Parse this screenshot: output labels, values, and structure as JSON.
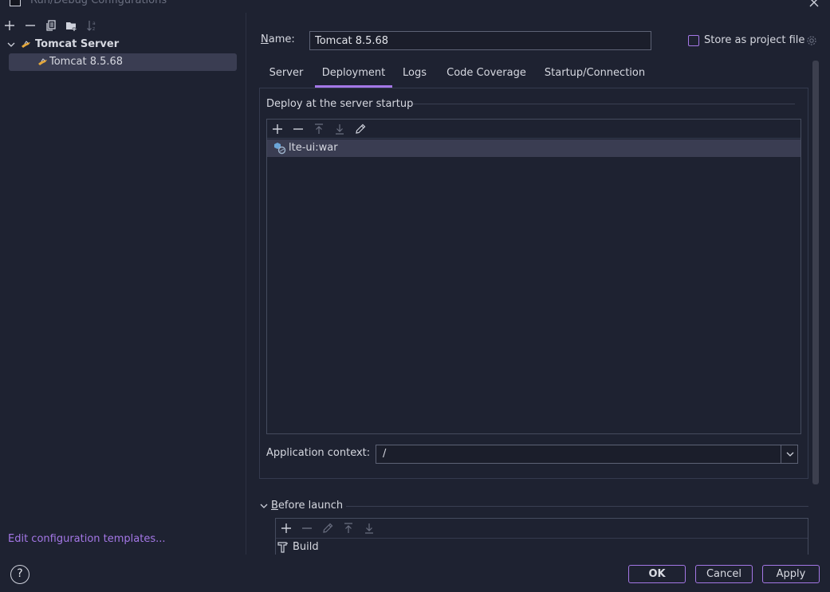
{
  "window": {
    "title": "Run/Debug Configurations",
    "close_icon": "close-icon",
    "app_icon": "intellij-app-icon"
  },
  "left": {
    "toolbar": [
      "add-icon",
      "remove-icon",
      "copy-icon",
      "new-folder-icon",
      "sort-icon"
    ],
    "tree": {
      "group_label": "Tomcat Server",
      "group_icon": "tomcat-icon",
      "items": [
        {
          "label": "Tomcat 8.5.68",
          "icon": "tomcat-icon",
          "selected": true
        }
      ]
    },
    "edit_templates_link": "Edit configuration templates...",
    "help_label": "?"
  },
  "config": {
    "name_label": "Name:",
    "name_value": "Tomcat 8.5.68",
    "store_label": "Store as project file",
    "store_checked": false,
    "tabs": [
      {
        "label": "Server",
        "active": false
      },
      {
        "label": "Deployment",
        "active": true
      },
      {
        "label": "Logs",
        "active": false
      },
      {
        "label": "Code Coverage",
        "active": false
      },
      {
        "label": "Startup/Connection",
        "active": false
      }
    ]
  },
  "deployment": {
    "heading": "Deploy at the server startup",
    "toolbar": [
      "add-icon",
      "remove-icon",
      "move-up-icon",
      "move-down-icon",
      "edit-icon"
    ],
    "artifacts": [
      {
        "label": "lte-ui:war",
        "icon": "artifact-icon",
        "selected": true
      }
    ],
    "app_context_label": "Application context:",
    "app_context_value": "/"
  },
  "before_launch": {
    "label": "Before launch",
    "expanded": true,
    "toolbar": [
      "add-icon",
      "remove-icon",
      "edit-icon",
      "move-up-icon",
      "move-down-icon"
    ],
    "tasks": [
      {
        "label": "Build",
        "icon": "build-hammer-icon"
      }
    ]
  },
  "buttons": {
    "ok": "OK",
    "cancel": "Cancel",
    "apply": "Apply"
  },
  "colors": {
    "background": "#1e2231",
    "accent": "#a477e6",
    "selection": "#3a3d52",
    "border": "#5d6275",
    "text": "#d6d8e0"
  }
}
